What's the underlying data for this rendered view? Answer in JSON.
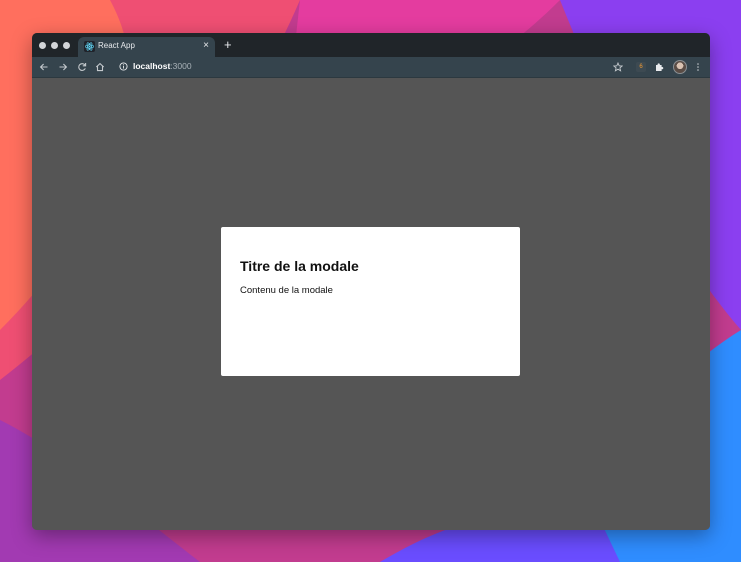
{
  "browser": {
    "tab": {
      "title": "React App",
      "close_label": "×",
      "favicon": "react-logo-icon"
    },
    "new_tab_label": "+",
    "address_bar": {
      "host": "localhost",
      "port": ":3000"
    },
    "extension_badge": "6",
    "colors": {
      "titlebar": "#202529",
      "toolbar": "#35444d",
      "page_backdrop": "#555555"
    }
  },
  "modal": {
    "title": "Titre de la modale",
    "content": "Contenu de la modale"
  }
}
